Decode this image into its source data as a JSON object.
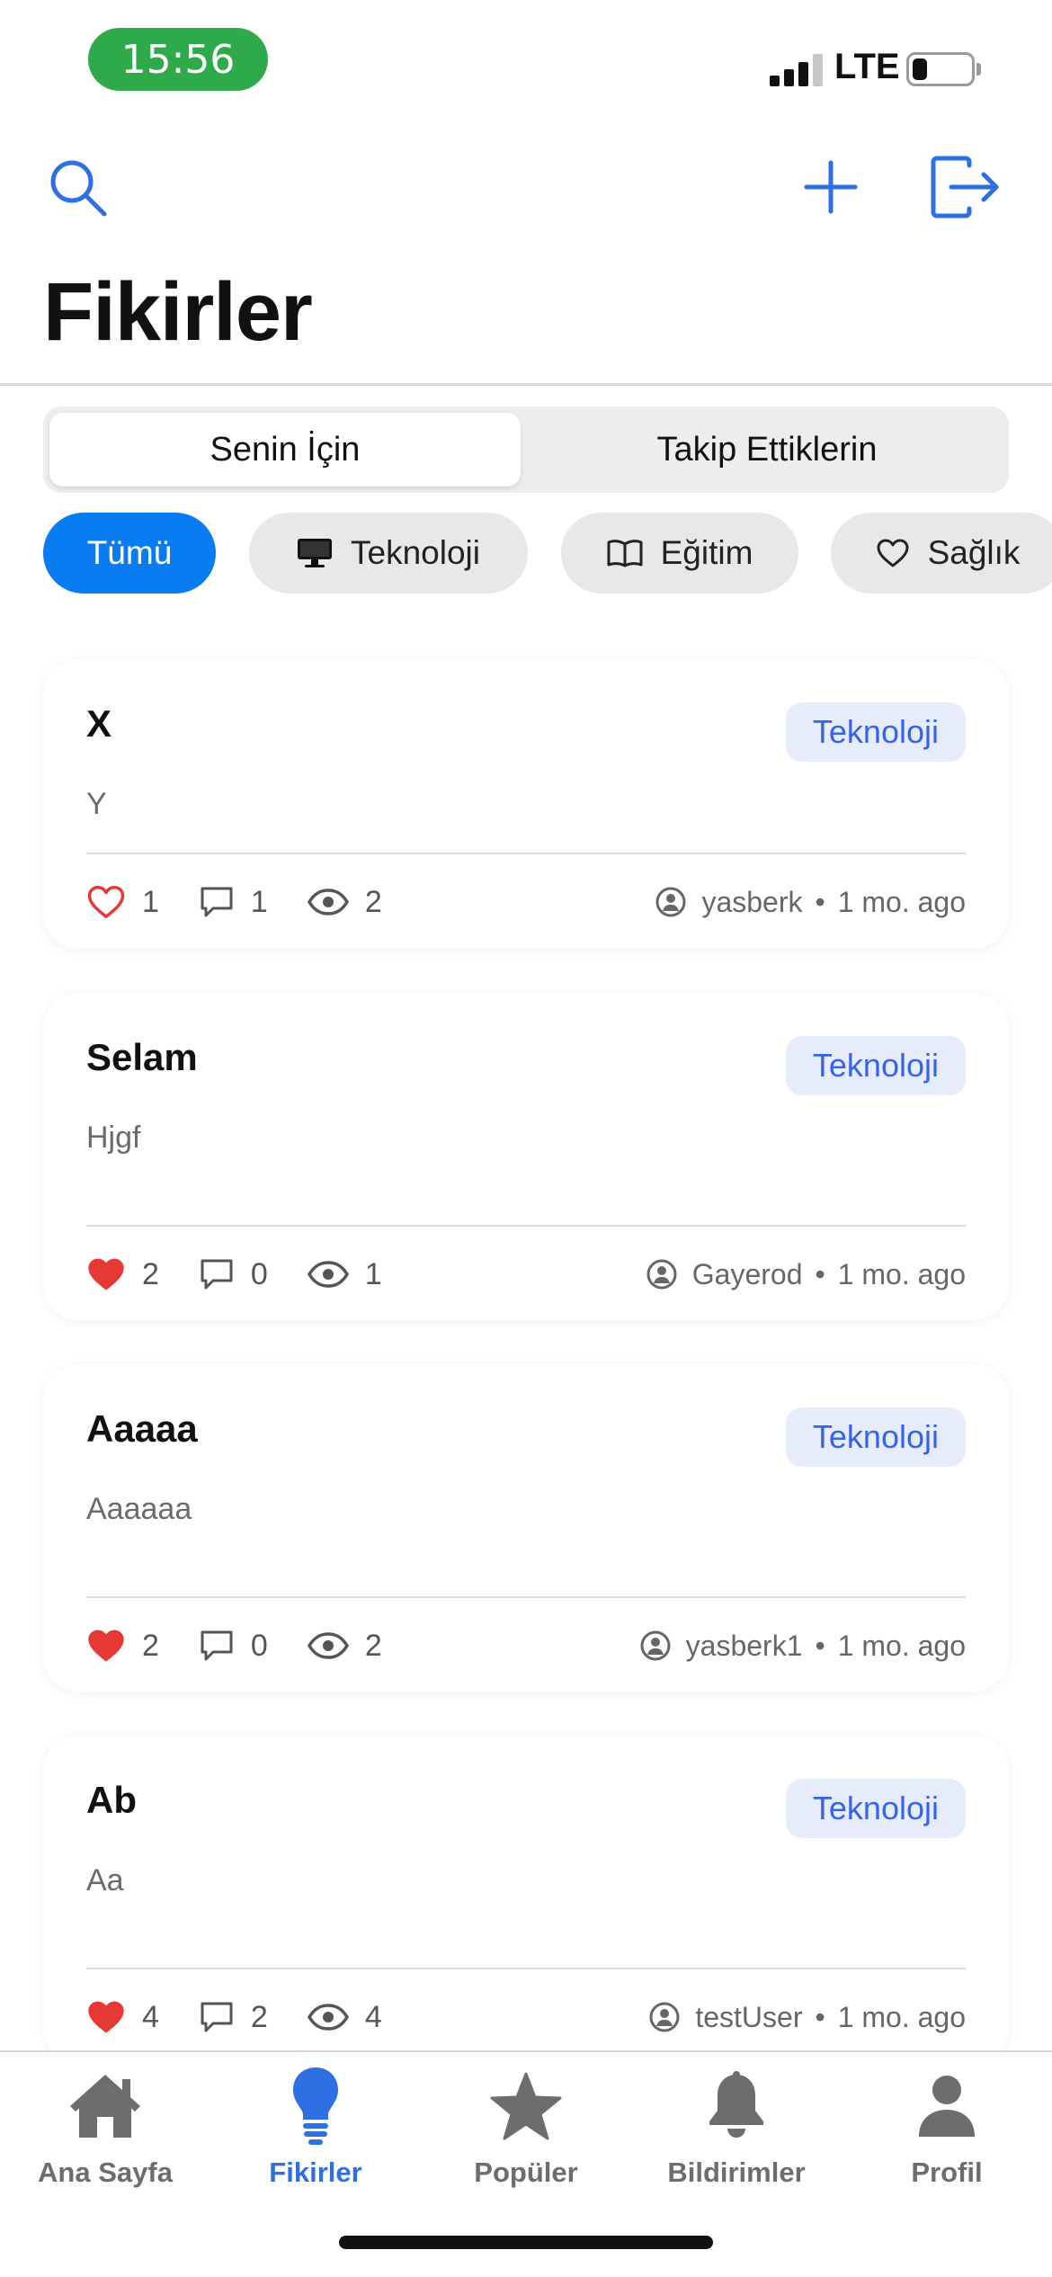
{
  "status_bar": {
    "time": "15:56",
    "network": "LTE",
    "battery_level": 0.25
  },
  "header": {
    "title": "Fikirler",
    "icons": [
      "search-icon",
      "plus-icon",
      "logout-icon"
    ]
  },
  "segmented": {
    "tabs": [
      "Senin İçin",
      "Takip Ettiklerin"
    ],
    "selected": 0
  },
  "categories": {
    "items": [
      {
        "label": "Tümü",
        "icon": "",
        "active": true
      },
      {
        "label": "Teknoloji",
        "icon": "desktop-icon",
        "active": false
      },
      {
        "label": "Eğitim",
        "icon": "book-icon",
        "active": false
      },
      {
        "label": "Sağlık",
        "icon": "heart-icon",
        "active": false
      }
    ]
  },
  "posts": [
    {
      "title": "X",
      "body": "Y",
      "category": "Teknoloji",
      "likes": "1",
      "liked": false,
      "comments": "1",
      "views": "2",
      "author": "yasberk",
      "time": "1 mo. ago"
    },
    {
      "title": "Selam",
      "body": "Hjgf",
      "category": "Teknoloji",
      "likes": "2",
      "liked": true,
      "comments": "0",
      "views": "1",
      "author": "Gayerod",
      "time": "1 mo. ago"
    },
    {
      "title": "Aaaaa",
      "body": "Aaaaaa",
      "category": "Teknoloji",
      "likes": "2",
      "liked": true,
      "comments": "0",
      "views": "2",
      "author": "yasberk1",
      "time": "1 mo. ago"
    },
    {
      "title": "Ab",
      "body": "Aa",
      "category": "Teknoloji",
      "likes": "4",
      "liked": true,
      "comments": "2",
      "views": "4",
      "author": "testUser",
      "time": "1 mo. ago"
    }
  ],
  "meta_separator": "•",
  "tabbar": {
    "items": [
      {
        "label": "Ana Sayfa",
        "icon": "house-icon"
      },
      {
        "label": "Fikirler",
        "icon": "lightbulb-icon"
      },
      {
        "label": "Popüler",
        "icon": "star-icon"
      },
      {
        "label": "Bildirimler",
        "icon": "bell-icon"
      },
      {
        "label": "Profil",
        "icon": "person-icon"
      }
    ],
    "selected": 1
  },
  "colors": {
    "accent": "#2f6fe4",
    "chip_active": "#0a7cf2",
    "badge_bg": "#e7ecfd",
    "like_red": "#e53935",
    "status_green": "#2faa4a"
  }
}
